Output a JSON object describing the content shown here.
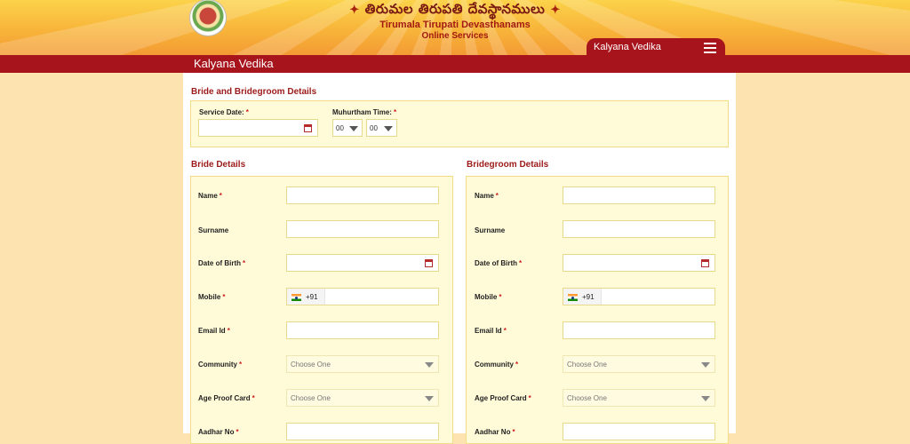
{
  "header": {
    "telugu_title": "తిరుమల తిరుపతి దేవస్థానములు",
    "org_name": "Tirumala Tirupati Devasthanams",
    "org_sub": "Online Services",
    "menu_label": "Kalyana Vedika"
  },
  "page": {
    "title": "Kalyana Vedika"
  },
  "details": {
    "title": "Bride and Bridegroom Details",
    "service_date_label": "Service Date:",
    "muhurtham_label": "Muhurtham Time:",
    "hour_value": "00",
    "minute_value": "00"
  },
  "bride": {
    "title": "Bride Details",
    "name": "Name",
    "surname": "Surname",
    "dob": "Date of Birth",
    "mobile": "Mobile",
    "country_code": "+91",
    "email": "Email Id",
    "community": "Community",
    "community_placeholder": "Choose One",
    "age_proof": "Age Proof Card",
    "age_proof_placeholder": "Choose One",
    "aadhar": "Aadhar No"
  },
  "groom": {
    "title": "Bridegroom Details",
    "name": "Name",
    "surname": "Surname",
    "dob": "Date of Birth",
    "mobile": "Mobile",
    "country_code": "+91",
    "email": "Email Id",
    "community": "Community",
    "community_placeholder": "Choose One",
    "age_proof": "Age Proof Card",
    "age_proof_placeholder": "Choose One",
    "aadhar": "Aadhar No"
  },
  "required_mark": "*",
  "colors": {
    "brand_red": "#a8141c",
    "field_bg": "#fffbd8",
    "field_border": "#f2dd86",
    "page_bg": "#fde3b0"
  },
  "icons": [
    "temple-logo-icon",
    "om-icon",
    "hamburger-menu-icon",
    "calendar-icon",
    "india-flag-icon",
    "dropdown-arrow-icon"
  ]
}
